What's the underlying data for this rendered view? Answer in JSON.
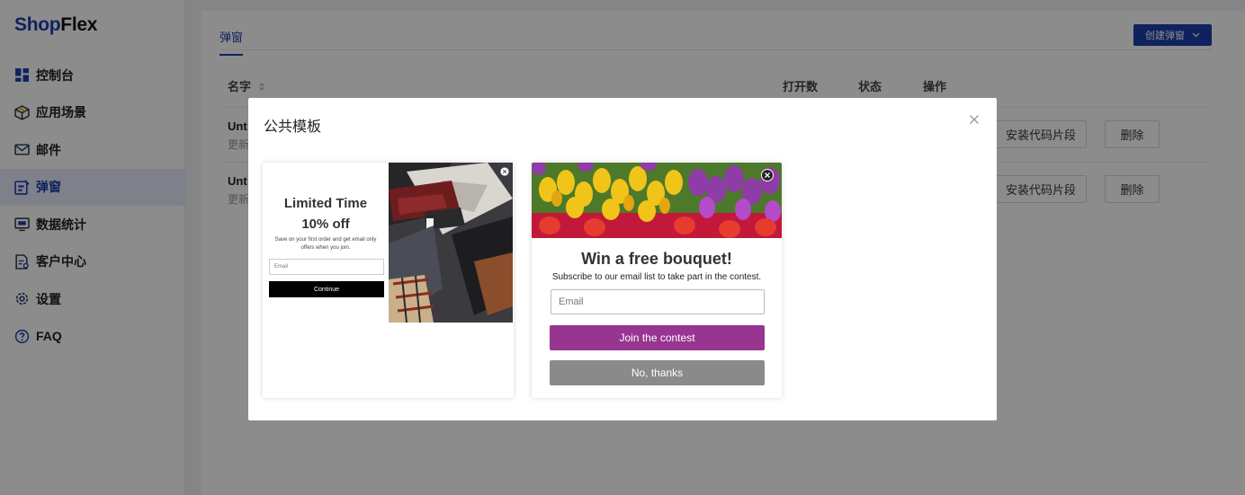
{
  "app": {
    "logo_part1": "Shop",
    "logo_part2": "Flex"
  },
  "sidebar": {
    "items": [
      {
        "label": "控制台",
        "icon": "dashboard-icon"
      },
      {
        "label": "应用场景",
        "icon": "box-icon"
      },
      {
        "label": "邮件",
        "icon": "mail-icon"
      },
      {
        "label": "弹窗",
        "icon": "popup-icon",
        "active": true
      },
      {
        "label": "数据统计",
        "icon": "monitor-icon"
      },
      {
        "label": "客户中心",
        "icon": "customer-doc-icon"
      },
      {
        "label": "设置",
        "icon": "gear-icon"
      },
      {
        "label": "FAQ",
        "icon": "help-icon"
      }
    ]
  },
  "main": {
    "tab_label": "弹窗",
    "create_button": "创建弹窗",
    "columns": {
      "name": "名字",
      "opens": "打开数",
      "status": "状态",
      "actions": "操作"
    },
    "rows": [
      {
        "name": "Unt",
        "sub": "更新",
        "install": "安装代码片段",
        "delete": "删除"
      },
      {
        "name": "Unt",
        "sub": "更新",
        "install": "安装代码片段",
        "delete": "删除"
      }
    ]
  },
  "modal": {
    "title": "公共模板",
    "templates": [
      {
        "title": "Limited Time",
        "discount": "10% off",
        "description": "Save on your first order and get email only offers when you join.",
        "email_placeholder": "Email",
        "button": "Continue"
      },
      {
        "title": "Win a free bouquet!",
        "subtitle": "Subscribe to our email list to take part in the contest.",
        "email_placeholder": "Email",
        "join_button": "Join the contest",
        "decline_button": "No, thanks"
      }
    ]
  },
  "colors": {
    "brand": "#1d3fae",
    "join": "#973591",
    "decline": "#8a8a8a"
  }
}
